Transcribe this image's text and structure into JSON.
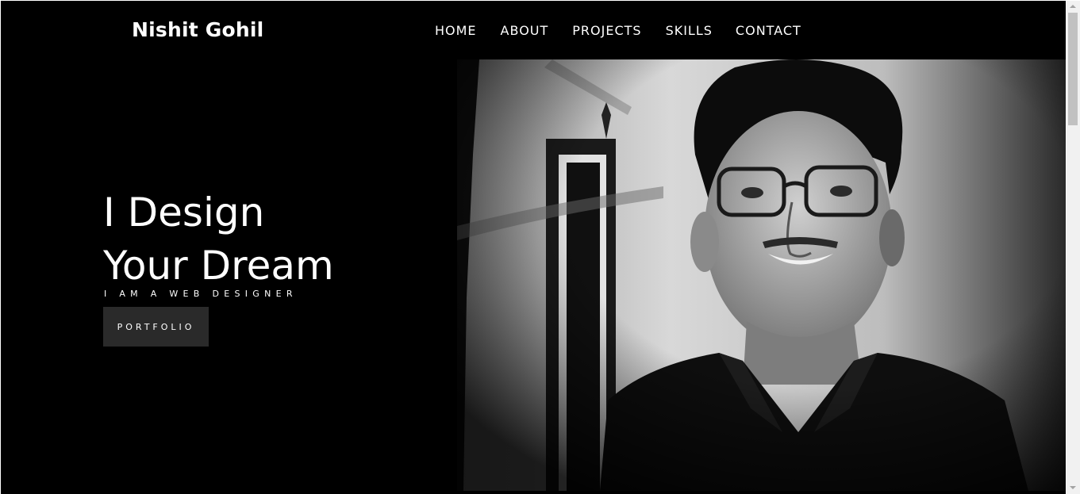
{
  "header": {
    "brand": "Nishit Gohil",
    "nav": [
      "HOME",
      "ABOUT",
      "PROJECTS",
      "SKILLS",
      "CONTACT"
    ]
  },
  "hero": {
    "headline_line1": "I Design",
    "headline_line2": "Your Dream",
    "tagline": "I AM A WEB DESIGNER",
    "button_label": "PORTFOLIO"
  },
  "colors": {
    "background": "#000000",
    "text": "#ffffff",
    "button_bg": "#2a2a2a"
  }
}
